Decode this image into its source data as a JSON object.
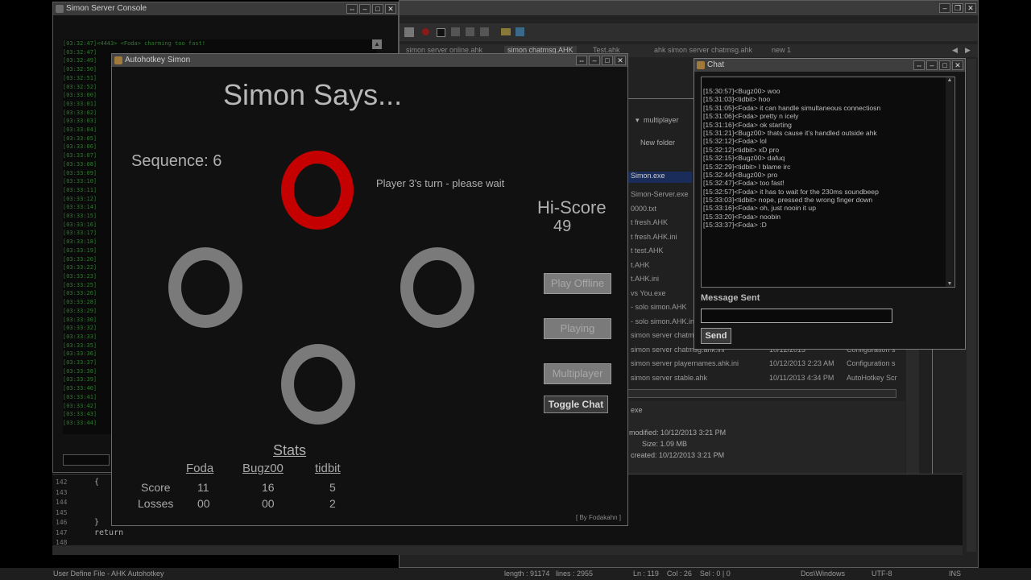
{
  "console": {
    "title": "Simon Server Console",
    "lines": [
      "[03:32:47]<4443> <Foda> charming too fast!",
      "[03:32:47]",
      "[03:32:49]",
      "[03:32:50]",
      "[03:32:51]",
      "[03:32:52]",
      "[03:33:00]",
      "[03:33:01]",
      "[03:33:02]",
      "[03:33:03]",
      "[03:33:04]",
      "[03:33:05]",
      "[03:33:06]",
      "[03:33:07]",
      "[03:33:08]",
      "[03:33:09]",
      "[03:33:10]",
      "[03:33:11]",
      "[03:33:12]",
      "[03:33:14]",
      "[03:33:15]",
      "[03:33:16]",
      "[03:33:17]",
      "[03:33:18]",
      "[03:33:19]",
      "[03:33:20]",
      "[03:33:22]",
      "[03:33:23]",
      "[03:33:25]",
      "[03:33:26]",
      "[03:33:28]",
      "[03:33:29]",
      "[03:33:30]",
      "[03:33:32]",
      "[03:33:33]",
      "[03:33:35]",
      "[03:33:36]",
      "[03:33:37]",
      "[03:33:38]",
      "[03:33:39]",
      "[03:33:40]",
      "[03:33:41]",
      "[03:33:42]",
      "[03:33:43]",
      "[03:33:44]"
    ]
  },
  "editor": {
    "tabs": [
      "simon server online.ahk",
      "simon chatmsg.AHK",
      "Test.ahk",
      "ahk simon server chatmsg.ahk",
      "new 1"
    ],
    "line_numbers": [
      "142",
      "143",
      "144",
      "145",
      "146",
      "147",
      "148"
    ],
    "code_lines": [
      "{",
      "",
      "",
      "",
      "}",
      "return",
      ""
    ],
    "status": {
      "file_type": "User Define File - AHK Autohotkey",
      "length": "length : 91174",
      "lines": "lines : 2955",
      "position": "Ln : 119    Col : 26    Sel : 0 | 0",
      "eol": "Dos\\Windows",
      "encoding": "UTF-8",
      "mode": "INS"
    }
  },
  "explorer": {
    "path": "multiplayer",
    "new_folder": "New folder",
    "files": [
      {
        "name": "Simon.exe",
        "date": "",
        "type": ""
      },
      {
        "name": "Simon-Server.exe",
        "date": "",
        "type": ""
      },
      {
        "name": "0000.txt",
        "date": "",
        "type": ""
      },
      {
        "name": "t fresh.AHK",
        "date": "",
        "type": ""
      },
      {
        "name": "t fresh.AHK.ini",
        "date": "",
        "type": ""
      },
      {
        "name": "t test.AHK",
        "date": "",
        "type": ""
      },
      {
        "name": "t.AHK",
        "date": "",
        "type": ""
      },
      {
        "name": "t.AHK.ini",
        "date": "",
        "type": ""
      },
      {
        "name": "vs You.exe",
        "date": "",
        "type": ""
      },
      {
        "name": "- solo simon.AHK",
        "date": "",
        "type": ""
      },
      {
        "name": "- solo simon.AHK.ini",
        "date": "",
        "type": ""
      },
      {
        "name": "simon server chatm",
        "date": "",
        "type": ""
      },
      {
        "name": "simon server chatmsg.ahk.ini",
        "date": "10/12/2013",
        "type": "Configuration s"
      },
      {
        "name": "simon server playernames.ahk.ini",
        "date": "10/12/2013 2:23 AM",
        "type": "Configuration s"
      },
      {
        "name": "simon server stable.ahk",
        "date": "10/11/2013 4:34 PM",
        "type": "AutoHotkey Scr"
      }
    ],
    "details": {
      "ext": "exe",
      "modified": "modified:  10/12/2013 3:21 PM",
      "size": "Size:  1.09 MB",
      "created": "created:  10/12/2013 3:21 PM"
    }
  },
  "simon": {
    "window_title": "Autohotkey Simon",
    "heading": "Simon Says...",
    "sequence": "Sequence: 6",
    "turn_message": "Player 3's turn - please wait",
    "hiscore_label": "Hi-Score",
    "hiscore_value": "49",
    "pad_glyph": "O",
    "buttons": {
      "play_offline": "Play Offline",
      "playing": "Playing",
      "multiplayer": "Multiplayer",
      "toggle_chat": "Toggle Chat"
    },
    "stats": {
      "title": "Stats",
      "players": [
        "Foda",
        "Bugz00",
        "tidbit"
      ],
      "score_label": "Score",
      "losses_label": "Losses",
      "scores": [
        "11",
        "16",
        "5"
      ],
      "losses": [
        "00",
        "00",
        "2"
      ]
    },
    "credit": "[ By Fodakahn ]",
    "colors": {
      "active": "#c40000",
      "inactive": "#7a7a7a"
    }
  },
  "chat": {
    "title": "Chat",
    "messages": [
      "[15:30:57]<Bugz00> woo",
      "[15:31:03]<tidbit> hoo",
      "[15:31:05]<Foda> it can handle simultaneous connectiosn",
      "[15:31:06]<Foda> pretty n icely",
      "[15:31:16]<Foda> ok starting",
      "[15:31:21]<Bugz00> thats cause it's handled outside ahk",
      "[15:32:12]<Foda> lol",
      "[15:32:12]<tidbit> xD pro",
      "[15:32:15]<Bugz00> dafuq",
      "[15:32:29]<tidbit> I blame irc",
      "[15:32:44]<Bugz00> pro",
      "[15:32:47]<Foda> too fast!",
      "[15:32:57]<Foda> it has to wait for the 230ms soundbeep",
      "[15:33:03]<tidbit> nope, pressed the wrong finger down",
      "[15:33:16]<Foda> oh, just nooin it up",
      "[15:33:20]<Foda> noobin",
      "[15:33:37]<Foda> :D"
    ],
    "status_label": "Message Sent",
    "input_value": "",
    "send_label": "Send"
  }
}
